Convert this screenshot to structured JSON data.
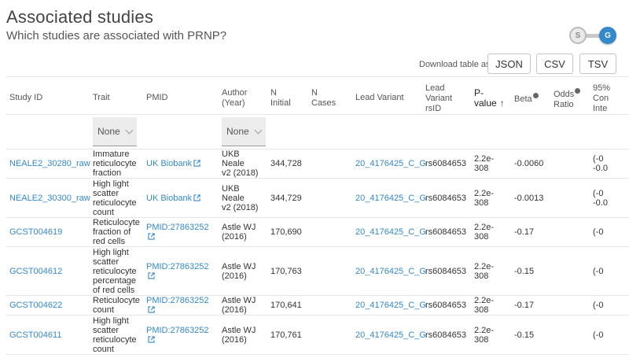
{
  "header": {
    "title": "Associated studies",
    "subtitle": "Which studies are associated with PRNP?"
  },
  "toggle": {
    "left_label": "S",
    "right_label": "G",
    "selected": "G"
  },
  "download": {
    "label": "Download table as",
    "json": "JSON",
    "csv": "CSV",
    "tsv": "TSV"
  },
  "columns": {
    "study_id": "Study ID",
    "trait": "Trait",
    "pmid": "PMID",
    "author_line1": "Author",
    "author_line2": "(Year)",
    "n_initial_line1": "N",
    "n_initial_line2": "Initial",
    "n_cases_line1": "N",
    "n_cases_line2": "Cases",
    "lead_variant": "Lead Variant",
    "rsid_line1": "Lead",
    "rsid_line2": "Variant",
    "rsid_line3": "rsID",
    "pvalue_line1": "P-",
    "pvalue_line2": "value",
    "beta": "Beta",
    "odds_line1": "Odds",
    "odds_line2": "Ratio",
    "ci_line1": "95%",
    "ci_line2": "Con",
    "ci_line3": "Inte"
  },
  "filters": {
    "trait": "None",
    "author": "None"
  },
  "rows": [
    {
      "id": "NEALE2_30280_raw",
      "trait": [
        "Immature",
        "reticulocyte",
        "fraction"
      ],
      "pmid": "UK Biobank",
      "author": [
        "UKB Neale",
        "v2 (2018)"
      ],
      "n_initial": "344,728",
      "n_cases": "",
      "lead_variant": "20_4176425_C_G",
      "rsid": "rs6084653",
      "pvalue": [
        "2.2e-",
        "308"
      ],
      "beta": "-0.0060",
      "odds": "",
      "ci": [
        "(-0",
        "-0.0"
      ]
    },
    {
      "id": "NEALE2_30300_raw",
      "trait": [
        "High light",
        "scatter",
        "reticulocyte",
        "count"
      ],
      "pmid": "UK Biobank",
      "author": [
        "UKB Neale",
        "v2 (2018)"
      ],
      "n_initial": "344,729",
      "n_cases": "",
      "lead_variant": "20_4176425_C_G",
      "rsid": "rs6084653",
      "pvalue": [
        "2.2e-",
        "308"
      ],
      "beta": "-0.0013",
      "odds": "",
      "ci": [
        "(-0",
        "-0.0"
      ]
    },
    {
      "id": "GCST004619",
      "trait": [
        "Reticulocyte",
        "fraction of",
        "red cells"
      ],
      "pmid": "PMID:27863252",
      "author": [
        "Astle WJ",
        "(2016)"
      ],
      "n_initial": "170,690",
      "n_cases": "",
      "lead_variant": "20_4176425_C_G",
      "rsid": "rs6084653",
      "pvalue": [
        "2.2e-",
        "308"
      ],
      "beta": "-0.17",
      "odds": "",
      "ci": [
        "(-0"
      ]
    },
    {
      "id": "GCST004612",
      "trait": [
        "High light",
        "scatter",
        "reticulocyte",
        "percentage",
        "of red cells"
      ],
      "pmid": "PMID:27863252",
      "author": [
        "Astle WJ",
        "(2016)"
      ],
      "n_initial": "170,763",
      "n_cases": "",
      "lead_variant": "20_4176425_C_G",
      "rsid": "rs6084653",
      "pvalue": [
        "2.2e-",
        "308"
      ],
      "beta": "-0.15",
      "odds": "",
      "ci": [
        "(-0"
      ]
    },
    {
      "id": "GCST004622",
      "trait": [
        "Reticulocyte",
        "count"
      ],
      "pmid": "PMID:27863252",
      "author": [
        "Astle WJ",
        "(2016)"
      ],
      "n_initial": "170,641",
      "n_cases": "",
      "lead_variant": "20_4176425_C_G",
      "rsid": "rs6084653",
      "pvalue": [
        "2.2e-",
        "308"
      ],
      "beta": "-0.17",
      "odds": "",
      "ci": [
        "(-0"
      ]
    },
    {
      "id": "GCST004611",
      "trait": [
        "High light",
        "scatter",
        "reticulocyte",
        "count"
      ],
      "pmid": "PMID:27863252",
      "author": [
        "Astle WJ",
        "(2016)"
      ],
      "n_initial": "170,761",
      "n_cases": "",
      "lead_variant": "20_4176425_C_G",
      "rsid": "rs6084653",
      "pvalue": [
        "2.2e-",
        "308"
      ],
      "beta": "-0.15",
      "odds": "",
      "ci": [
        "(-0"
      ]
    }
  ],
  "colors": {
    "link": "#3489ca",
    "toggle_active": "#3489ca"
  }
}
